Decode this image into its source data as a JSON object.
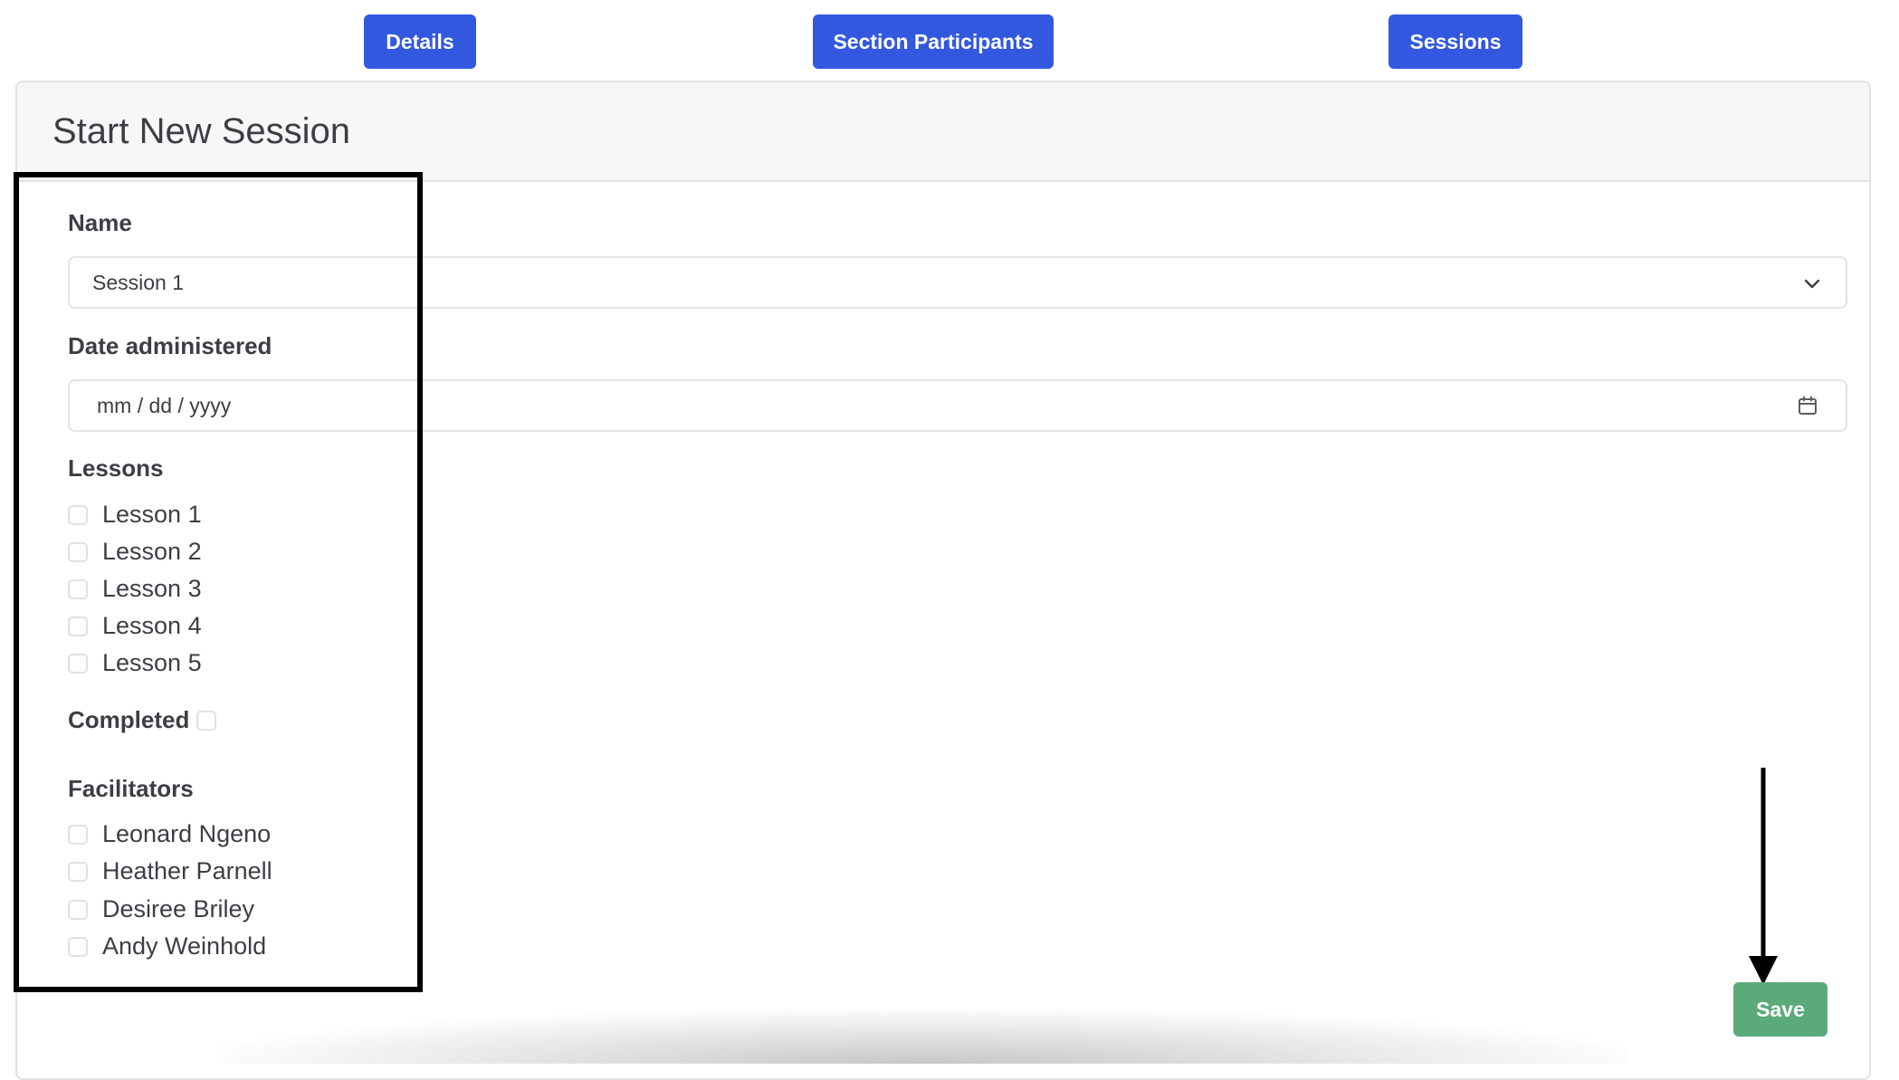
{
  "tabs": {
    "details": "Details",
    "participants": "Section Participants",
    "sessions": "Sessions"
  },
  "card": {
    "title": "Start New Session"
  },
  "form": {
    "name_label": "Name",
    "name_value": "Session 1",
    "date_label": "Date administered",
    "date_placeholder": "mm / dd / yyyy",
    "lessons_label": "Lessons",
    "lessons": [
      "Lesson 1",
      "Lesson 2",
      "Lesson 3",
      "Lesson 4",
      "Lesson 5"
    ],
    "completed_label": "Completed",
    "facilitators_label": "Facilitators",
    "facilitators": [
      "Leonard Ngeno",
      "Heather Parnell",
      "Desiree Briley",
      "Andy Weinhold"
    ]
  },
  "actions": {
    "save": "Save"
  },
  "colors": {
    "tab_bg": "#3358e0",
    "save_bg": "#5aaa7a",
    "annotation": "#000000"
  },
  "icons": [
    "chevron-down-icon",
    "calendar-icon",
    "arrow-down-icon"
  ]
}
